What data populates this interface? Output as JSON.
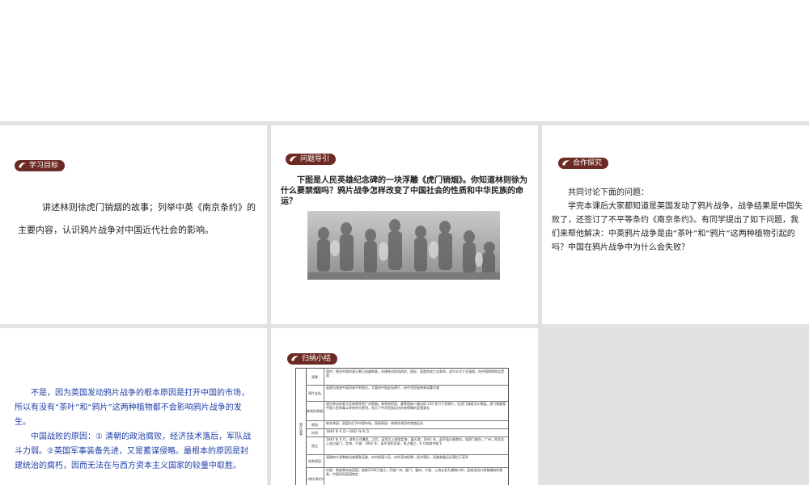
{
  "colors": {
    "badge": "#6d2a22",
    "blue_text": "#1f3fa8",
    "gap": "#e2e2e2"
  },
  "panel1": {
    "badge": "学习目标",
    "text": "讲述林则徐虎门销烟的故事；列举中英《南京条约》的主要内容，认识鸦片战争对中国近代社会的影响。"
  },
  "panel2": {
    "badge": "问题导引",
    "text": "下图是人民英雄纪念碑的一块浮雕《虎门销烟》。你知道林则徐为什么要禁烟吗？鸦片战争怎样改变了中国社会的性质和中华民族的命运？",
    "image_icon": "relief-sculpture-image"
  },
  "panel3": {
    "badge": "合作探究",
    "line1": "共同讨论下面的问题：",
    "line2": "学完本课后大家都知道是英国发动了鸦片战争，战争结果是中国失败了，还签订了不平等条约《南京条约》。有同学提出了如下问题，我们来帮他解决：中英鸦片战争是由“茶叶”和“鸦片”这两种植物引起的吗？中国在鸦片战争中为什么会失败？"
  },
  "panel4": {
    "para1": "不是，因为英国发动鸦片战争的根本原因是打开中国的市场，所以有没有“茶叶”和“鸦片”这两种植物都不会影响鸦片战争的发生。",
    "para2": "中国战败的原因：① 清朝的政治腐败，经济技术落后，军队战斗力弱。②英国军事装备先进，又是蓄谋侵略。最根本的原因是封建统治的腐朽，因而无法在与西方资本主义国家的较量中取胜。"
  },
  "panel5": {
    "badge": "归纳小结",
    "table": {
      "side_label": "鸦片战争",
      "rows": [
        {
          "label": "背景",
          "text": "国内：统治中国的清王朝已由盛转衰，封建统治危机四伏。国际：英国完成工业革命，成为头号工业强国，向中国倾销商品受阻"
        },
        {
          "label": "鸦片走私",
          "text": "英国为改变中英贸易不利地位，大量向中国走私鸦片，给中华民族带来深重灾难"
        },
        {
          "label": "林则徐禁烟",
          "text": "道光帝派钦差大臣林则徐到广州禁烟。林则徐把英、美等国商人缴出的 110 多万千克鸦片，在虎门海滩当众销毁。虎门销烟是中国人民禁毒斗争的伟大胜利，显示了中华民族反抗外来侵略的坚强意志"
        },
        {
          "label": "原因",
          "text": "根本原因：英国为打开中国市场。直接原因：林则徐领导的禁烟运动"
        },
        {
          "label": "时间",
          "text": "1840 年 6 月—1842 年 8 月"
        },
        {
          "label": "经过",
          "text": "1840 年 6 月，战争正式爆发。之后，英军北上攻陷定海，逼天津；1841 年，英军强占香港岛，攻虎门炮台，广州；再次北上攻占厦门，定海，宁波；1842 年，英军进犯吴淞，攻占镇江，8 月抵南京城下"
        },
        {
          "label": "失败原因",
          "text": "清政府大多数统治者腐败无能，对内残害人民，对外妥协投降；经济落后，武器装备远远落后于英军"
        },
        {
          "label": "《南京条约》",
          "text": "内容：割香港岛给英国；赔款2100万银元；开放广州、厦门、福州、宁波、上海五处为通商口岸；英商进出口货物缴纳的税款，中国须同英国商定"
        }
      ]
    }
  }
}
